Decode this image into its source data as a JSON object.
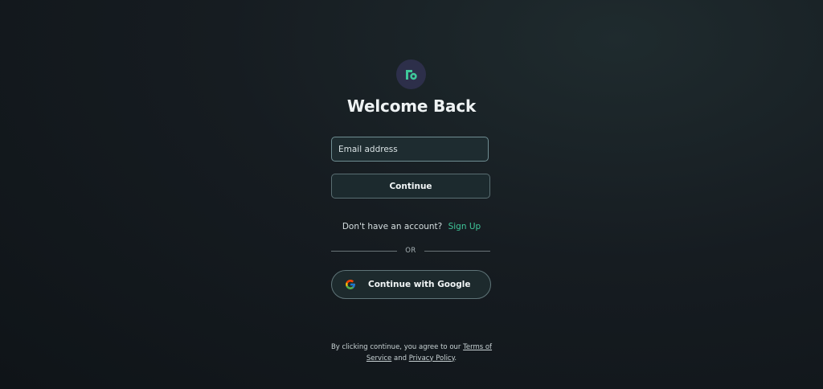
{
  "auth": {
    "title": "Welcome Back",
    "email_placeholder": "Email address",
    "continue_label": "Continue",
    "signup_prompt": "Don't have an account?",
    "signup_link": "Sign Up",
    "divider_text": "OR",
    "google_label": "Continue with Google"
  },
  "footer": {
    "prefix": "By clicking continue, you agree to our",
    "terms_line1": "Terms of",
    "terms_line2": "Service",
    "and_text": "and",
    "privacy_link": "Privacy Policy",
    "suffix": "."
  },
  "colors": {
    "accent": "#3fc79a",
    "logo_bg": "#2d2f4a",
    "background": "#161c21"
  },
  "icons": {
    "logo": "app-logo-icon",
    "google": "google-icon"
  }
}
